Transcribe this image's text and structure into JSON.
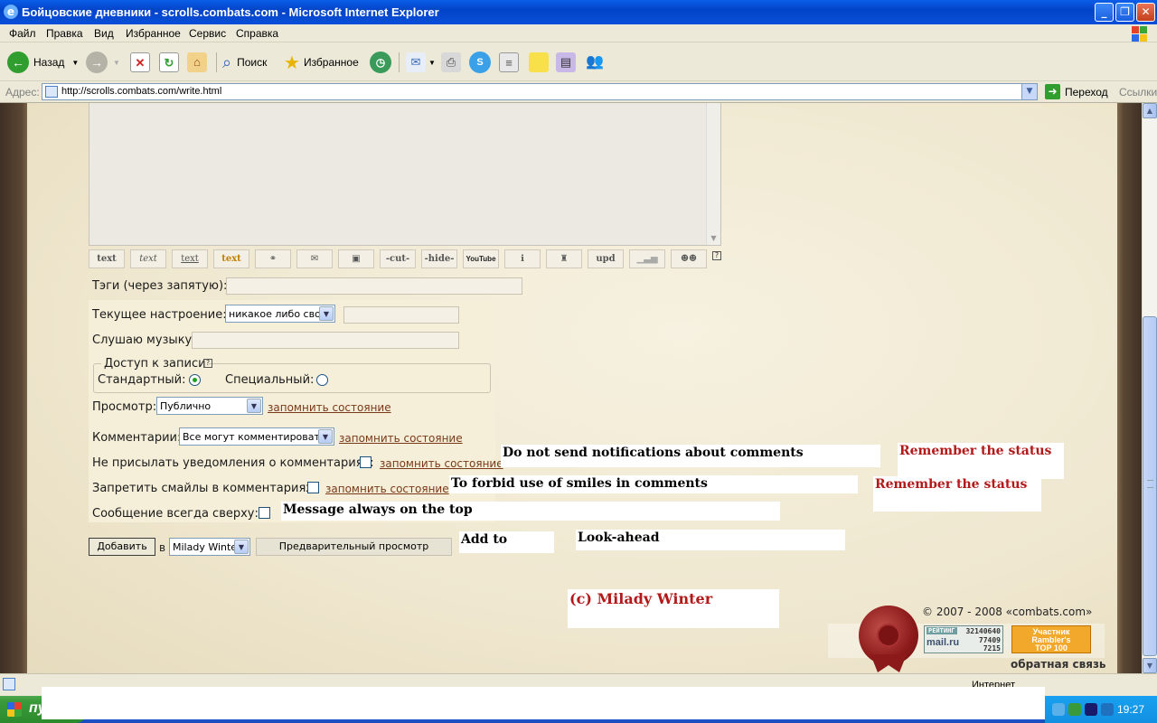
{
  "window": {
    "title": "Бойцовские дневники - scrolls.combats.com - Microsoft Internet Explorer"
  },
  "menu": [
    "Файл",
    "Правка",
    "Вид",
    "Избранное",
    "Сервис",
    "Справка"
  ],
  "toolbar": {
    "back_label": "Назад",
    "search_label": "Поиск",
    "favorites_label": "Избранное"
  },
  "address": {
    "label": "Адрес:",
    "url": "http://scrolls.combats.com/write.html",
    "go_label": "Переход",
    "links_label": "Ссылки"
  },
  "format_buttons": [
    "text",
    "text",
    "text",
    "text",
    "",
    "",
    "",
    "-cut-",
    "-hide-",
    "YouTube",
    "",
    "",
    "upd",
    "",
    ""
  ],
  "form": {
    "tags_label": "Тэги (через запятую):",
    "mood_label": "Текущее настроение:",
    "mood_value": "никакое либо свое",
    "music_label": "Слушаю музыку:",
    "access_legend": "Доступ к записи",
    "access_standard": "Стандартный:",
    "access_special": "Специальный:",
    "view_label": "Просмотр:",
    "view_value": "Публично",
    "remember_label": "запомнить состояние",
    "comments_label": "Комментарии:",
    "comments_value": "Все могут комментировать",
    "no_notify_label": "Не присылать уведомления о комментариях:",
    "no_smiles_label": "Запретить смайлы в комментариях:",
    "always_top_label": "Сообщение всегда сверху:",
    "add_button": "Добавить",
    "in_label": "в",
    "target_value": "Milady Winter",
    "preview_button": "Предварительный просмотр"
  },
  "overlays": {
    "no_notify_en": "Do not send notifications about comments",
    "remember_en_1": "Remember the status",
    "no_smiles_en": "To forbid use of smiles in comments",
    "remember_en_2": "Remember the status",
    "always_top_en": "Message always on the top",
    "add_to_en": "Add to",
    "lookahead_en": "Look-ahead",
    "copyright_en": "(c) Milady Winter"
  },
  "footer": {
    "copyright_prefix": "© 2007 - 2008 «",
    "copyright_site": "combats.com",
    "copyright_suffix": "»",
    "feedback": "обратная связь",
    "counter1_label": "РЕЙТИНГ",
    "counter1_logo": "mail.ru",
    "counter1_n1": "32140640",
    "counter1_n2": "77409",
    "counter1_n3": "7215",
    "counter2_line1": "Участник",
    "counter2_line2": "Rambler's",
    "counter2_line3": "TOP 100"
  },
  "statusbar": {
    "zone": "Интернет"
  },
  "taskbar": {
    "start_label": "пу",
    "clock": "19:27"
  },
  "colors": {
    "overlay_red": "#b21a1a",
    "link": "#7a3a1a",
    "parchment": "#f2ebd4"
  }
}
